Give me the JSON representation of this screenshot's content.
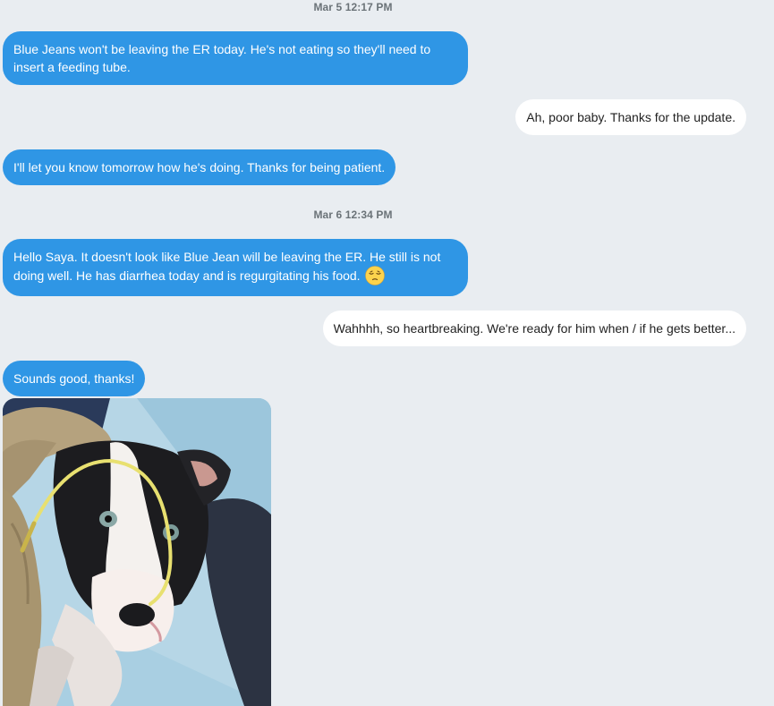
{
  "conversation": {
    "timestamps": [
      "Mar 5 12:17 PM",
      "Mar 6 12:34 PM"
    ],
    "messages": [
      {
        "direction": "incoming",
        "text": "Blue Jeans won't be leaving the ER today. He's not eating so they'll need to insert a feeding tube."
      },
      {
        "direction": "outgoing",
        "text": "Ah, poor baby. Thanks for the update."
      },
      {
        "direction": "incoming",
        "text": "I'll let you know tomorrow how he's doing. Thanks for being patient."
      },
      {
        "direction": "incoming",
        "text": "Hello Saya. It doesn't look like Blue Jean will be leaving the ER. He still is not doing well.  He has diarrhea today and is regurgitating his food.",
        "emoji": "pensive-face-icon"
      },
      {
        "direction": "outgoing",
        "text": "Wahhhh, so heartbreaking. We're ready for him when / if he gets better..."
      },
      {
        "direction": "incoming",
        "text": "Sounds good, thanks!"
      }
    ],
    "attachment": {
      "type": "photo",
      "subject": "puppy-with-feeding-tube"
    }
  },
  "colors": {
    "background": "#e9edf1",
    "incoming_bubble": "#2f96e5",
    "outgoing_bubble": "#ffffff",
    "timestamp_text": "#6b7378"
  }
}
